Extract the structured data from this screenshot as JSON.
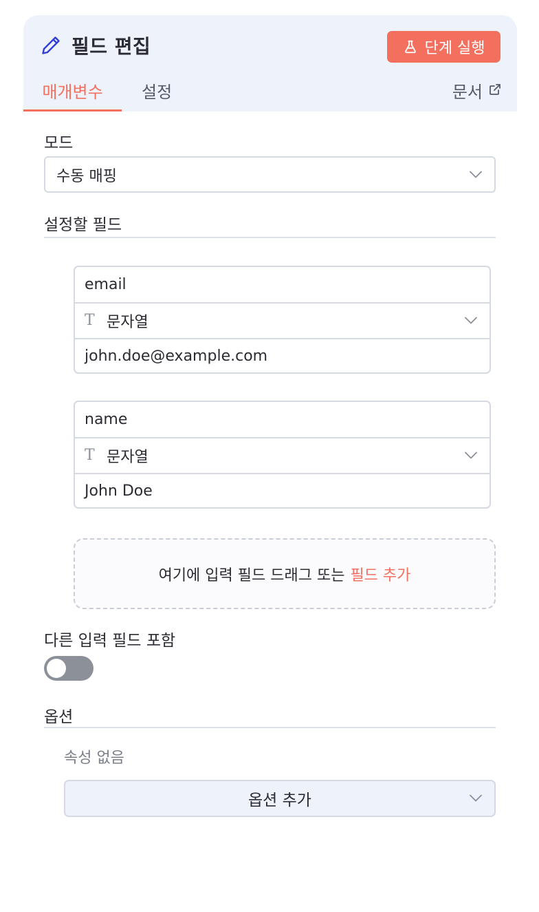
{
  "header": {
    "title": "필드 편집",
    "run_button": "단계 실행",
    "tabs": [
      {
        "label": "매개변수"
      },
      {
        "label": "설정"
      }
    ],
    "docs_link": "문서"
  },
  "mode": {
    "label": "모드",
    "value": "수동 매핑"
  },
  "fields_section": {
    "label": "설정할 필드",
    "fields": [
      {
        "name": "email",
        "type": "문자열",
        "value": "john.doe@example.com"
      },
      {
        "name": "name",
        "type": "문자열",
        "value": "John Doe"
      }
    ],
    "dropzone_text": "여기에 입력 필드 드래그 또는",
    "dropzone_link": "필드 추가"
  },
  "include_other": {
    "label": "다른 입력 필드 포함",
    "enabled": false
  },
  "options": {
    "label": "옵션",
    "empty_text": "속성 없음",
    "add_button": "옵션 추가"
  },
  "colors": {
    "accent": "#f4705e",
    "header_bg": "#eef2fb",
    "icon_blue": "#2f3fd6"
  }
}
